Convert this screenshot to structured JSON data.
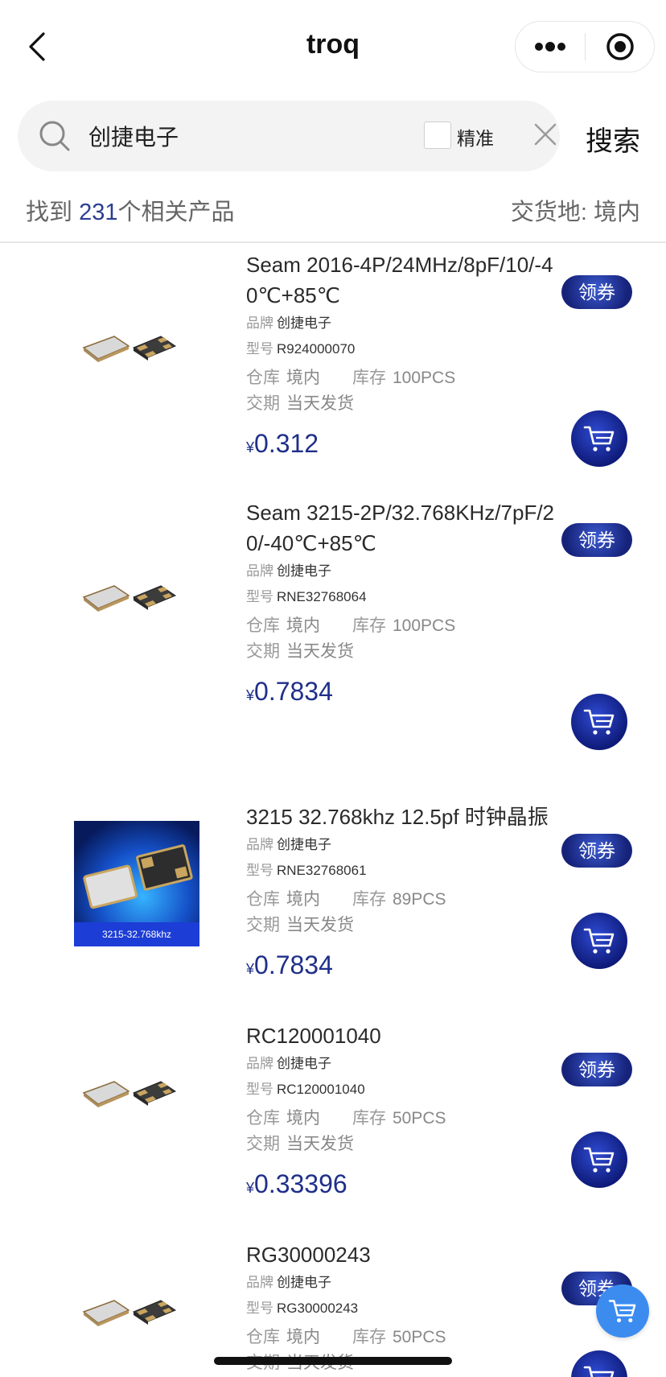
{
  "header": {
    "title": "troq",
    "back_icon": "chevron-left-icon",
    "more_icon": "more-dots-icon",
    "close_icon": "target-close-icon"
  },
  "search": {
    "query": "创捷电子",
    "exact_label": "精准",
    "exact_checked": false,
    "button_label": "搜索"
  },
  "results": {
    "prefix": "找到 ",
    "count": "231",
    "suffix": "个相关产品",
    "delivery_label": "交货地:",
    "delivery_value": "境内"
  },
  "labels": {
    "brand": "品牌",
    "model": "型号",
    "warehouse": "仓库",
    "stock": "库存",
    "lead_time": "交期",
    "coupon": "领券",
    "currency": "¥"
  },
  "products": [
    {
      "name": "Seam 2016-4P/24MHz/8pF/10/-40℃+85℃",
      "brand": "创捷电子",
      "model": "R924000070",
      "warehouse": "境内",
      "stock": "100PCS",
      "lead_time": "当天发货",
      "price": "0.312",
      "image": "crystal"
    },
    {
      "name": "Seam 3215-2P/32.768KHz/7pF/20/-40℃+85℃",
      "brand": "创捷电子",
      "model": "RNE32768064",
      "warehouse": "境内",
      "stock": "100PCS",
      "lead_time": "当天发货",
      "price": "0.7834",
      "image": "crystal"
    },
    {
      "name": "3215 32.768khz 12.5pf 时钟晶振",
      "brand": "创捷电子",
      "model": "RNE32768061",
      "warehouse": "境内",
      "stock": "89PCS",
      "lead_time": "当天发货",
      "price": "0.7834",
      "image": "banner",
      "image_caption": "3215-32.768khz"
    },
    {
      "name": "RC120001040",
      "brand": "创捷电子",
      "model": "RC120001040",
      "warehouse": "境内",
      "stock": "50PCS",
      "lead_time": "当天发货",
      "price": "0.33396",
      "image": "crystal"
    },
    {
      "name": "RG30000243",
      "brand": "创捷电子",
      "model": "RG30000243",
      "warehouse": "境内",
      "stock": "50PCS",
      "lead_time": "当天发货",
      "price": "",
      "image": "crystal"
    }
  ],
  "colors": {
    "accent": "#1f2f8a",
    "coupon_bg": "#1b2a8a",
    "float_cart": "#3c8cf0"
  }
}
